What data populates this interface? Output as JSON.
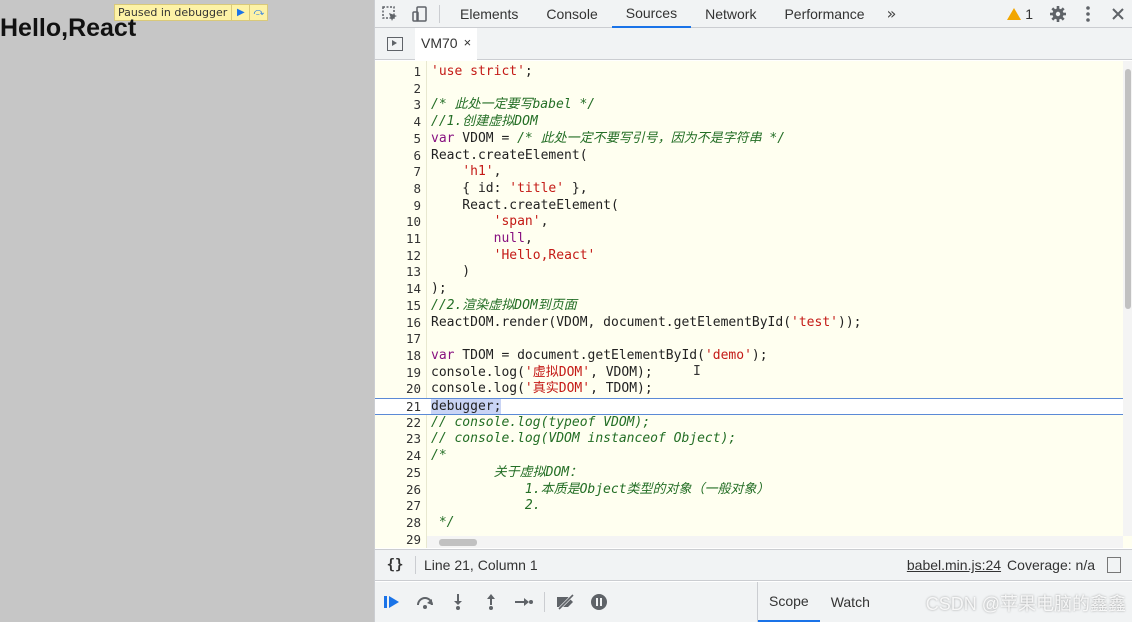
{
  "page": {
    "heading": "Hello,React",
    "paused_banner": {
      "label": "Paused in debugger",
      "resume_glyph": "▶",
      "step_glyph": "⤼"
    }
  },
  "devtools": {
    "tabs": [
      {
        "label": "Elements",
        "active": false
      },
      {
        "label": "Console",
        "active": false
      },
      {
        "label": "Sources",
        "active": true
      },
      {
        "label": "Network",
        "active": false
      },
      {
        "label": "Performance",
        "active": false
      }
    ],
    "more_tabs_glyph": "»",
    "warning_count": "1",
    "file_tab": {
      "label": "VM70",
      "close_glyph": "×"
    },
    "code_lines": [
      {
        "n": "1",
        "text": "'use strict';"
      },
      {
        "n": "2",
        "text": ""
      },
      {
        "n": "3",
        "text": "/* 此处一定要写babel */"
      },
      {
        "n": "4",
        "text": "//1.创建虚拟DOM"
      },
      {
        "n": "5",
        "text": "var VDOM = /* 此处一定不要写引号，因为不是字符串 */"
      },
      {
        "n": "6",
        "text": "React.createElement("
      },
      {
        "n": "7",
        "text": "    'h1',"
      },
      {
        "n": "8",
        "text": "    { id: 'title' },"
      },
      {
        "n": "9",
        "text": "    React.createElement("
      },
      {
        "n": "10",
        "text": "        'span',"
      },
      {
        "n": "11",
        "text": "        null,"
      },
      {
        "n": "12",
        "text": "        'Hello,React'"
      },
      {
        "n": "13",
        "text": "    )"
      },
      {
        "n": "14",
        "text": ");"
      },
      {
        "n": "15",
        "text": "//2.渲染虚拟DOM到页面"
      },
      {
        "n": "16",
        "text": "ReactDOM.render(VDOM, document.getElementById('test'));"
      },
      {
        "n": "17",
        "text": ""
      },
      {
        "n": "18",
        "text": "var TDOM = document.getElementById('demo');"
      },
      {
        "n": "19",
        "text": "console.log('虚拟DOM', VDOM);"
      },
      {
        "n": "20",
        "text": "console.log('真实DOM', TDOM);"
      },
      {
        "n": "21",
        "text": "debugger;"
      },
      {
        "n": "22",
        "text": "// console.log(typeof VDOM);"
      },
      {
        "n": "23",
        "text": "// console.log(VDOM instanceof Object);"
      },
      {
        "n": "24",
        "text": "/*"
      },
      {
        "n": "25",
        "text": "        关于虚拟DOM："
      },
      {
        "n": "26",
        "text": "            1.本质是Object类型的对象（一般对象）"
      },
      {
        "n": "27",
        "text": "            2."
      },
      {
        "n": "28",
        "text": " */"
      },
      {
        "n": "29",
        "text": ""
      }
    ],
    "status": {
      "pretty_print": "{}",
      "position": "Line 21, Column 1",
      "source_link": "babel.min.js:24",
      "coverage": "Coverage: n/a"
    },
    "side_tabs": [
      {
        "label": "Scope",
        "active": true
      },
      {
        "label": "Watch",
        "active": false
      }
    ]
  },
  "watermark": "CSDN @苹果电脑的鑫鑫",
  "colors": {
    "accent": "#1a73e8",
    "editor_bg": "#fffff0",
    "string": "#c41a16",
    "keyword": "#881280",
    "comment": "#236e25"
  }
}
